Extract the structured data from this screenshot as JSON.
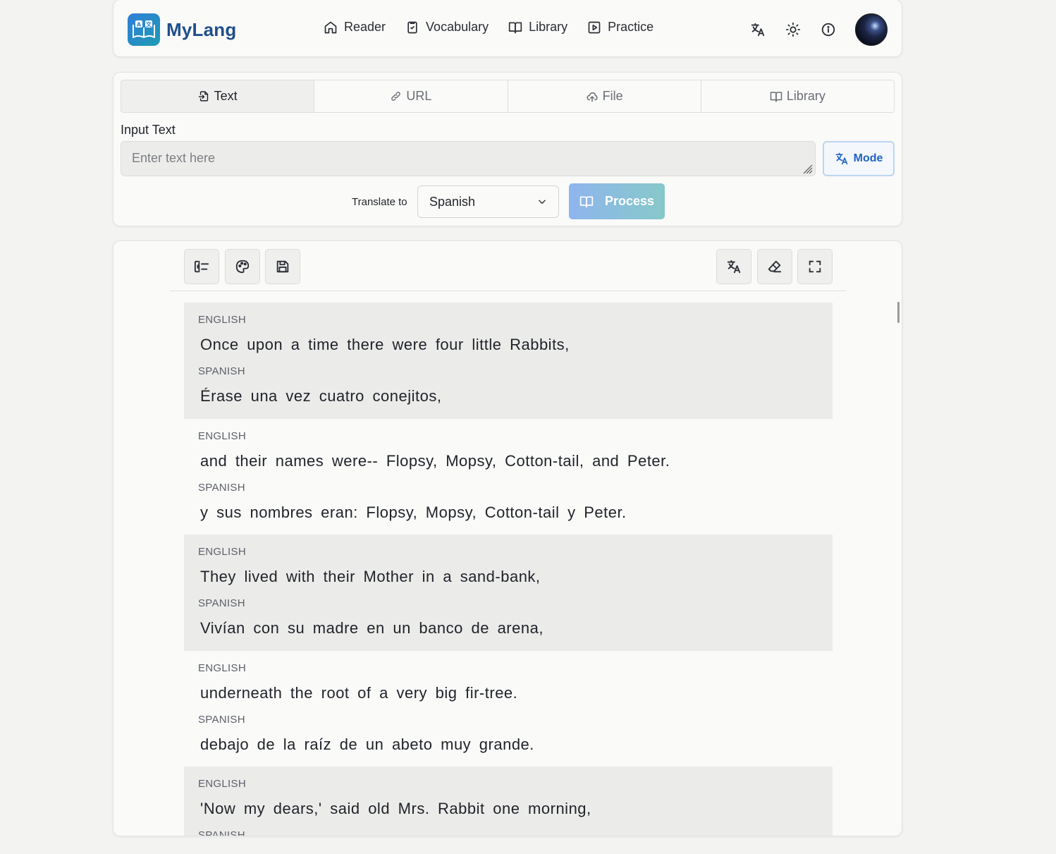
{
  "header": {
    "app_name": "MyLang",
    "nav": [
      {
        "label": "Reader",
        "icon": "home-icon"
      },
      {
        "label": "Vocabulary",
        "icon": "clipboard-check-icon"
      },
      {
        "label": "Library",
        "icon": "book-open-icon"
      },
      {
        "label": "Practice",
        "icon": "play-square-icon"
      }
    ],
    "icons": [
      "translate-icon",
      "sun-icon",
      "info-icon"
    ],
    "avatar": "user-avatar"
  },
  "input_card": {
    "tabs": [
      {
        "label": "Text",
        "icon": "file-import-icon",
        "active": true
      },
      {
        "label": "URL",
        "icon": "link-icon",
        "active": false
      },
      {
        "label": "File",
        "icon": "cloud-upload-icon",
        "active": false
      },
      {
        "label": "Library",
        "icon": "book-open-icon",
        "active": false
      }
    ],
    "input_label": "Input Text",
    "input_placeholder": "Enter text here",
    "input_value": "",
    "mode_label": "Mode",
    "translate_label": "Translate to",
    "target_language": "Spanish",
    "process_label": "Process"
  },
  "reader": {
    "toolbar_left": [
      "swap-lang-icon",
      "palette-icon",
      "save-icon"
    ],
    "toolbar_right": [
      "translate-icon",
      "eraser-icon",
      "fullscreen-icon"
    ],
    "blocks": [
      {
        "src_lang": "ENGLISH",
        "src": "Once upon a time there were four little Rabbits,",
        "tgt_lang": "SPANISH",
        "tgt": "Érase una vez cuatro conejitos,"
      },
      {
        "src_lang": "ENGLISH",
        "src": "and their names were-- Flopsy, Mopsy, Cotton-tail, and Peter.",
        "tgt_lang": "SPANISH",
        "tgt": "y sus nombres eran: Flopsy, Mopsy, Cotton-tail y Peter."
      },
      {
        "src_lang": "ENGLISH",
        "src": "They lived with their Mother in a sand-bank,",
        "tgt_lang": "SPANISH",
        "tgt": "Vivían con su madre en un banco de arena,"
      },
      {
        "src_lang": "ENGLISH",
        "src": "underneath the root of a very big fir-tree.",
        "tgt_lang": "SPANISH",
        "tgt": "debajo de la raíz de un abeto muy grande."
      },
      {
        "src_lang": "ENGLISH",
        "src": "'Now my dears,' said old Mrs. Rabbit one morning,",
        "tgt_lang": "SPANISH",
        "tgt": ""
      }
    ]
  },
  "colors": {
    "brand": "#1f4e8c",
    "accent": "#2064c4",
    "shaded_row": "#ebebea"
  }
}
